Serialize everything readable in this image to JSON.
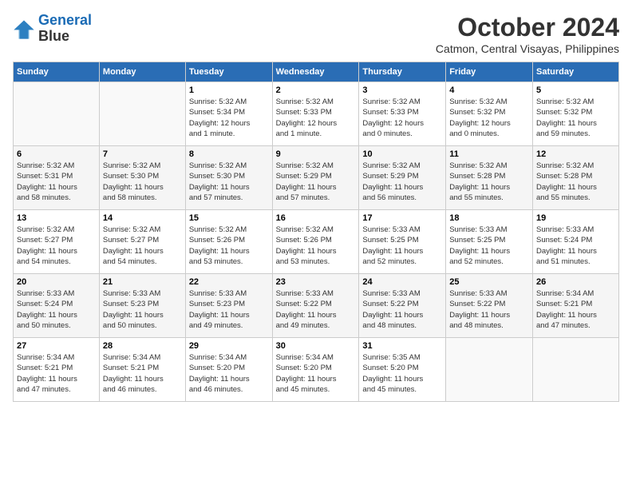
{
  "logo": {
    "line1": "General",
    "line2": "Blue"
  },
  "title": "October 2024",
  "subtitle": "Catmon, Central Visayas, Philippines",
  "days_of_week": [
    "Sunday",
    "Monday",
    "Tuesday",
    "Wednesday",
    "Thursday",
    "Friday",
    "Saturday"
  ],
  "weeks": [
    [
      {
        "day": "",
        "info": ""
      },
      {
        "day": "",
        "info": ""
      },
      {
        "day": "1",
        "info": "Sunrise: 5:32 AM\nSunset: 5:34 PM\nDaylight: 12 hours\nand 1 minute."
      },
      {
        "day": "2",
        "info": "Sunrise: 5:32 AM\nSunset: 5:33 PM\nDaylight: 12 hours\nand 1 minute."
      },
      {
        "day": "3",
        "info": "Sunrise: 5:32 AM\nSunset: 5:33 PM\nDaylight: 12 hours\nand 0 minutes."
      },
      {
        "day": "4",
        "info": "Sunrise: 5:32 AM\nSunset: 5:32 PM\nDaylight: 12 hours\nand 0 minutes."
      },
      {
        "day": "5",
        "info": "Sunrise: 5:32 AM\nSunset: 5:32 PM\nDaylight: 11 hours\nand 59 minutes."
      }
    ],
    [
      {
        "day": "6",
        "info": "Sunrise: 5:32 AM\nSunset: 5:31 PM\nDaylight: 11 hours\nand 58 minutes."
      },
      {
        "day": "7",
        "info": "Sunrise: 5:32 AM\nSunset: 5:30 PM\nDaylight: 11 hours\nand 58 minutes."
      },
      {
        "day": "8",
        "info": "Sunrise: 5:32 AM\nSunset: 5:30 PM\nDaylight: 11 hours\nand 57 minutes."
      },
      {
        "day": "9",
        "info": "Sunrise: 5:32 AM\nSunset: 5:29 PM\nDaylight: 11 hours\nand 57 minutes."
      },
      {
        "day": "10",
        "info": "Sunrise: 5:32 AM\nSunset: 5:29 PM\nDaylight: 11 hours\nand 56 minutes."
      },
      {
        "day": "11",
        "info": "Sunrise: 5:32 AM\nSunset: 5:28 PM\nDaylight: 11 hours\nand 55 minutes."
      },
      {
        "day": "12",
        "info": "Sunrise: 5:32 AM\nSunset: 5:28 PM\nDaylight: 11 hours\nand 55 minutes."
      }
    ],
    [
      {
        "day": "13",
        "info": "Sunrise: 5:32 AM\nSunset: 5:27 PM\nDaylight: 11 hours\nand 54 minutes."
      },
      {
        "day": "14",
        "info": "Sunrise: 5:32 AM\nSunset: 5:27 PM\nDaylight: 11 hours\nand 54 minutes."
      },
      {
        "day": "15",
        "info": "Sunrise: 5:32 AM\nSunset: 5:26 PM\nDaylight: 11 hours\nand 53 minutes."
      },
      {
        "day": "16",
        "info": "Sunrise: 5:32 AM\nSunset: 5:26 PM\nDaylight: 11 hours\nand 53 minutes."
      },
      {
        "day": "17",
        "info": "Sunrise: 5:33 AM\nSunset: 5:25 PM\nDaylight: 11 hours\nand 52 minutes."
      },
      {
        "day": "18",
        "info": "Sunrise: 5:33 AM\nSunset: 5:25 PM\nDaylight: 11 hours\nand 52 minutes."
      },
      {
        "day": "19",
        "info": "Sunrise: 5:33 AM\nSunset: 5:24 PM\nDaylight: 11 hours\nand 51 minutes."
      }
    ],
    [
      {
        "day": "20",
        "info": "Sunrise: 5:33 AM\nSunset: 5:24 PM\nDaylight: 11 hours\nand 50 minutes."
      },
      {
        "day": "21",
        "info": "Sunrise: 5:33 AM\nSunset: 5:23 PM\nDaylight: 11 hours\nand 50 minutes."
      },
      {
        "day": "22",
        "info": "Sunrise: 5:33 AM\nSunset: 5:23 PM\nDaylight: 11 hours\nand 49 minutes."
      },
      {
        "day": "23",
        "info": "Sunrise: 5:33 AM\nSunset: 5:22 PM\nDaylight: 11 hours\nand 49 minutes."
      },
      {
        "day": "24",
        "info": "Sunrise: 5:33 AM\nSunset: 5:22 PM\nDaylight: 11 hours\nand 48 minutes."
      },
      {
        "day": "25",
        "info": "Sunrise: 5:33 AM\nSunset: 5:22 PM\nDaylight: 11 hours\nand 48 minutes."
      },
      {
        "day": "26",
        "info": "Sunrise: 5:34 AM\nSunset: 5:21 PM\nDaylight: 11 hours\nand 47 minutes."
      }
    ],
    [
      {
        "day": "27",
        "info": "Sunrise: 5:34 AM\nSunset: 5:21 PM\nDaylight: 11 hours\nand 47 minutes."
      },
      {
        "day": "28",
        "info": "Sunrise: 5:34 AM\nSunset: 5:21 PM\nDaylight: 11 hours\nand 46 minutes."
      },
      {
        "day": "29",
        "info": "Sunrise: 5:34 AM\nSunset: 5:20 PM\nDaylight: 11 hours\nand 46 minutes."
      },
      {
        "day": "30",
        "info": "Sunrise: 5:34 AM\nSunset: 5:20 PM\nDaylight: 11 hours\nand 45 minutes."
      },
      {
        "day": "31",
        "info": "Sunrise: 5:35 AM\nSunset: 5:20 PM\nDaylight: 11 hours\nand 45 minutes."
      },
      {
        "day": "",
        "info": ""
      },
      {
        "day": "",
        "info": ""
      }
    ]
  ]
}
